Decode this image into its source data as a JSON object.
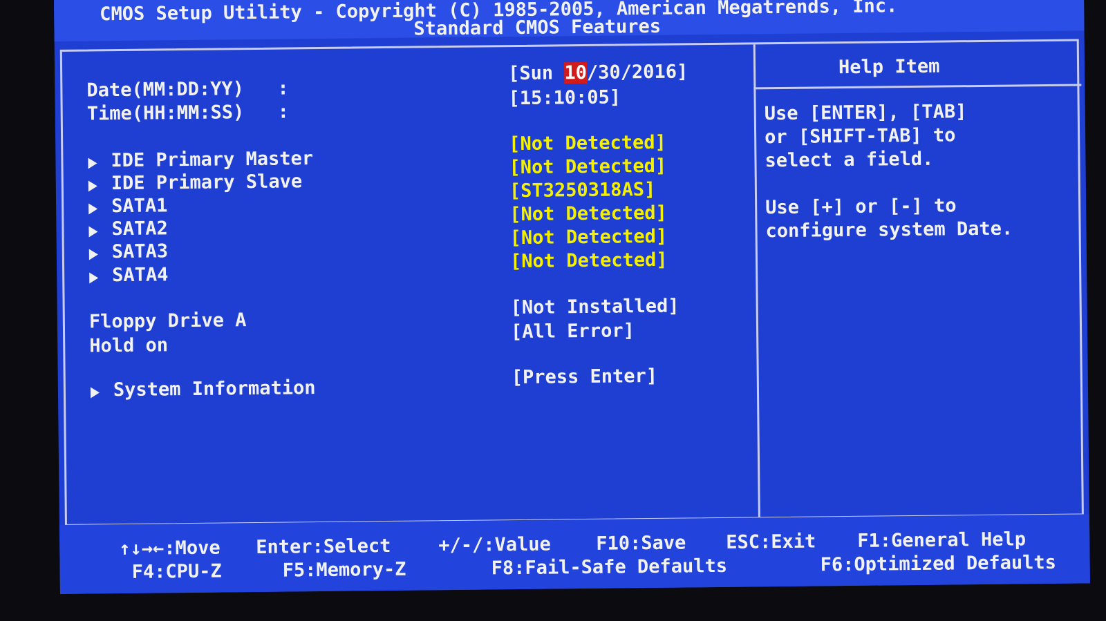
{
  "header": {
    "title": "CMOS Setup Utility - Copyright (C) 1985-2005, American Megatrends, Inc.",
    "subtitle": "Standard CMOS Features"
  },
  "date": {
    "label": "Date(MM:DD:YY)",
    "sep": ":",
    "prefix": "[Sun ",
    "month": "10",
    "rest": "/30/2016]"
  },
  "time": {
    "label": "Time(HH:MM:SS)",
    "sep": ":",
    "value": "[15:10:05]"
  },
  "devices": [
    {
      "label": "IDE Primary Master",
      "value": "[Not Detected]"
    },
    {
      "label": "IDE Primary Slave",
      "value": "[Not Detected]"
    },
    {
      "label": "SATA1",
      "value": "[ST3250318AS]"
    },
    {
      "label": "SATA2",
      "value": "[Not Detected]"
    },
    {
      "label": "SATA3",
      "value": "[Not Detected]"
    },
    {
      "label": "SATA4",
      "value": "[Not Detected]"
    }
  ],
  "floppy": {
    "label": "Floppy Drive A",
    "value": "[Not Installed]"
  },
  "hold": {
    "label": "Hold on",
    "value": "[All Error]"
  },
  "sysinfo": {
    "label": "System Information",
    "value": "[Press Enter]"
  },
  "help": {
    "title": "Help Item",
    "lines": [
      "Use [ENTER], [TAB]",
      "or [SHIFT-TAB] to",
      "select a field.",
      "",
      "Use [+] or [-] to",
      "configure system Date."
    ]
  },
  "footer": {
    "row1": [
      "↑↓→←:Move",
      "Enter:Select",
      "+/-/:Value",
      "F10:Save",
      "ESC:Exit",
      "F1:General Help"
    ],
    "row2": [
      "F4:CPU-Z",
      "F5:Memory-Z",
      "F8:Fail-Safe Defaults",
      "F6:Optimized Defaults"
    ]
  },
  "colors": {
    "background": "#1f3fd2",
    "value_text": "#f4f000",
    "label_text": "#f2f2f2",
    "selection": "#d21b1b"
  }
}
